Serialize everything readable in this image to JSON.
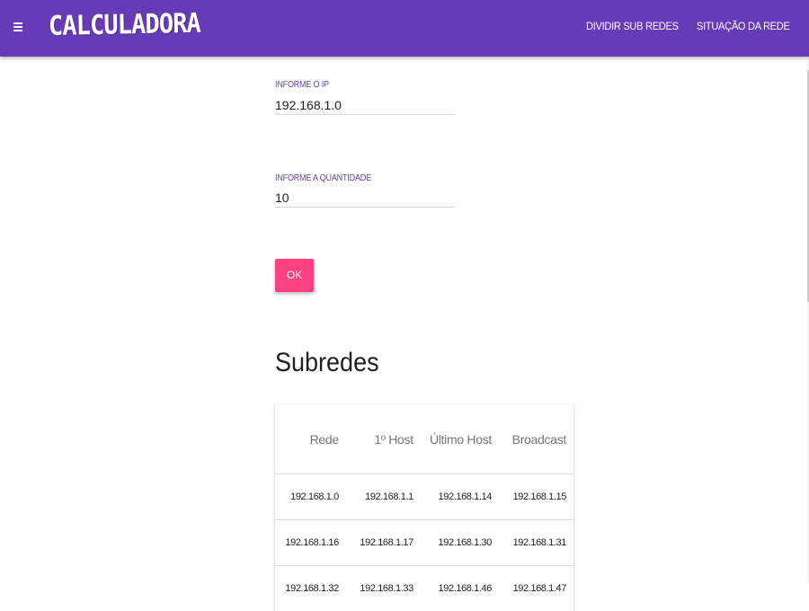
{
  "appbar": {
    "brand": "CALCULADORA",
    "nav": [
      "DIVIDIR SUB REDES",
      "SITUAÇÃO DA REDE"
    ],
    "color": "#673ab7"
  },
  "form": {
    "ip_label": "INFORME O IP",
    "ip_value": "192.168.1.0",
    "qty_label": "INFORME A QUANTIDADE",
    "qty_value": "10",
    "ok_label": "OK",
    "accent": "#ff4081"
  },
  "subnets": {
    "title": "Subredes",
    "columns": [
      "Rede",
      "1º Host",
      "Último Host",
      "Broadcast"
    ],
    "rows": [
      [
        "192.168.1.0",
        "192.168.1.1",
        "192.168.1.14",
        "192.168.1.15"
      ],
      [
        "192.168.1.16",
        "192.168.1.17",
        "192.168.1.30",
        "192.168.1.31"
      ],
      [
        "192.168.1.32",
        "192.168.1.33",
        "192.168.1.46",
        "192.168.1.47"
      ]
    ]
  }
}
